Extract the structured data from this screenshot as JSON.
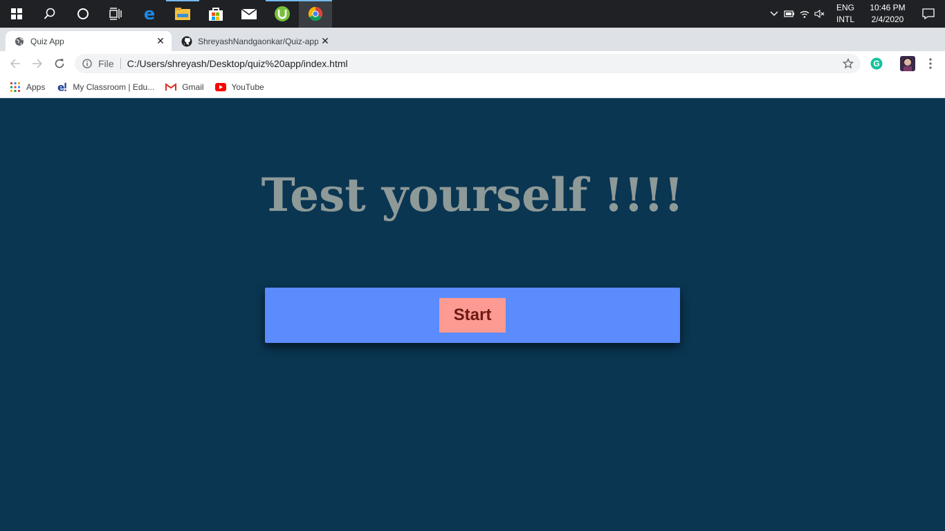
{
  "taskbar": {
    "apps": [
      "start-menu",
      "search",
      "cortana",
      "task-view",
      "edge",
      "file-explorer",
      "store",
      "mail",
      "utorrent",
      "chrome"
    ],
    "tray": {
      "lang_line1": "ENG",
      "lang_line2": "INTL",
      "time": "10:46 PM",
      "date": "2/4/2020"
    }
  },
  "browser": {
    "tabs": [
      {
        "title": "Quiz App",
        "active": true
      },
      {
        "title": "ShreyashNandgaonkar/Quiz-app",
        "active": false
      }
    ],
    "omnibox": {
      "scheme": "File",
      "url": "C:/Users/shreyash/Desktop/quiz%20app/index.html"
    },
    "bookmarks": [
      {
        "label": "Apps",
        "icon": "apps-grid-icon"
      },
      {
        "label": "My Classroom | Edu...",
        "icon": "edureka-icon"
      },
      {
        "label": "Gmail",
        "icon": "gmail-icon"
      },
      {
        "label": "YouTube",
        "icon": "youtube-icon"
      }
    ]
  },
  "page": {
    "heading": "Test yourself !!!!",
    "start_label": "Start"
  },
  "colors": {
    "background": "#0a3652",
    "heading": "#8e9a98",
    "panel": "#5b8bfc",
    "button": "#fd9a91",
    "button_text": "#6b1a14"
  }
}
